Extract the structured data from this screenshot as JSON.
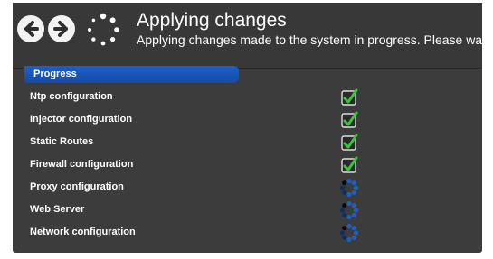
{
  "header": {
    "title": "Applying changes",
    "subtitle": "Applying changes made to the system in progress. Please wait",
    "back_icon": "arrow-left-circle-icon",
    "forward_icon": "arrow-right-circle-icon",
    "spinner_icon": "loading-spinner-icon"
  },
  "progress": {
    "label": "Progress",
    "tasks": [
      {
        "label": "Ntp configuration",
        "status": "done"
      },
      {
        "label": "Injector configuration",
        "status": "done"
      },
      {
        "label": "Static Routes",
        "status": "done"
      },
      {
        "label": "Firewall configuration",
        "status": "done"
      },
      {
        "label": "Proxy configuration",
        "status": "in-progress"
      },
      {
        "label": "Web Server",
        "status": "in-progress"
      },
      {
        "label": "Network configuration",
        "status": "in-progress"
      }
    ]
  },
  "colors": {
    "panel": "#3c3c3c",
    "accent": "#1a55b8",
    "check": "#3cc23c",
    "spinner": "#1d5fbf"
  }
}
